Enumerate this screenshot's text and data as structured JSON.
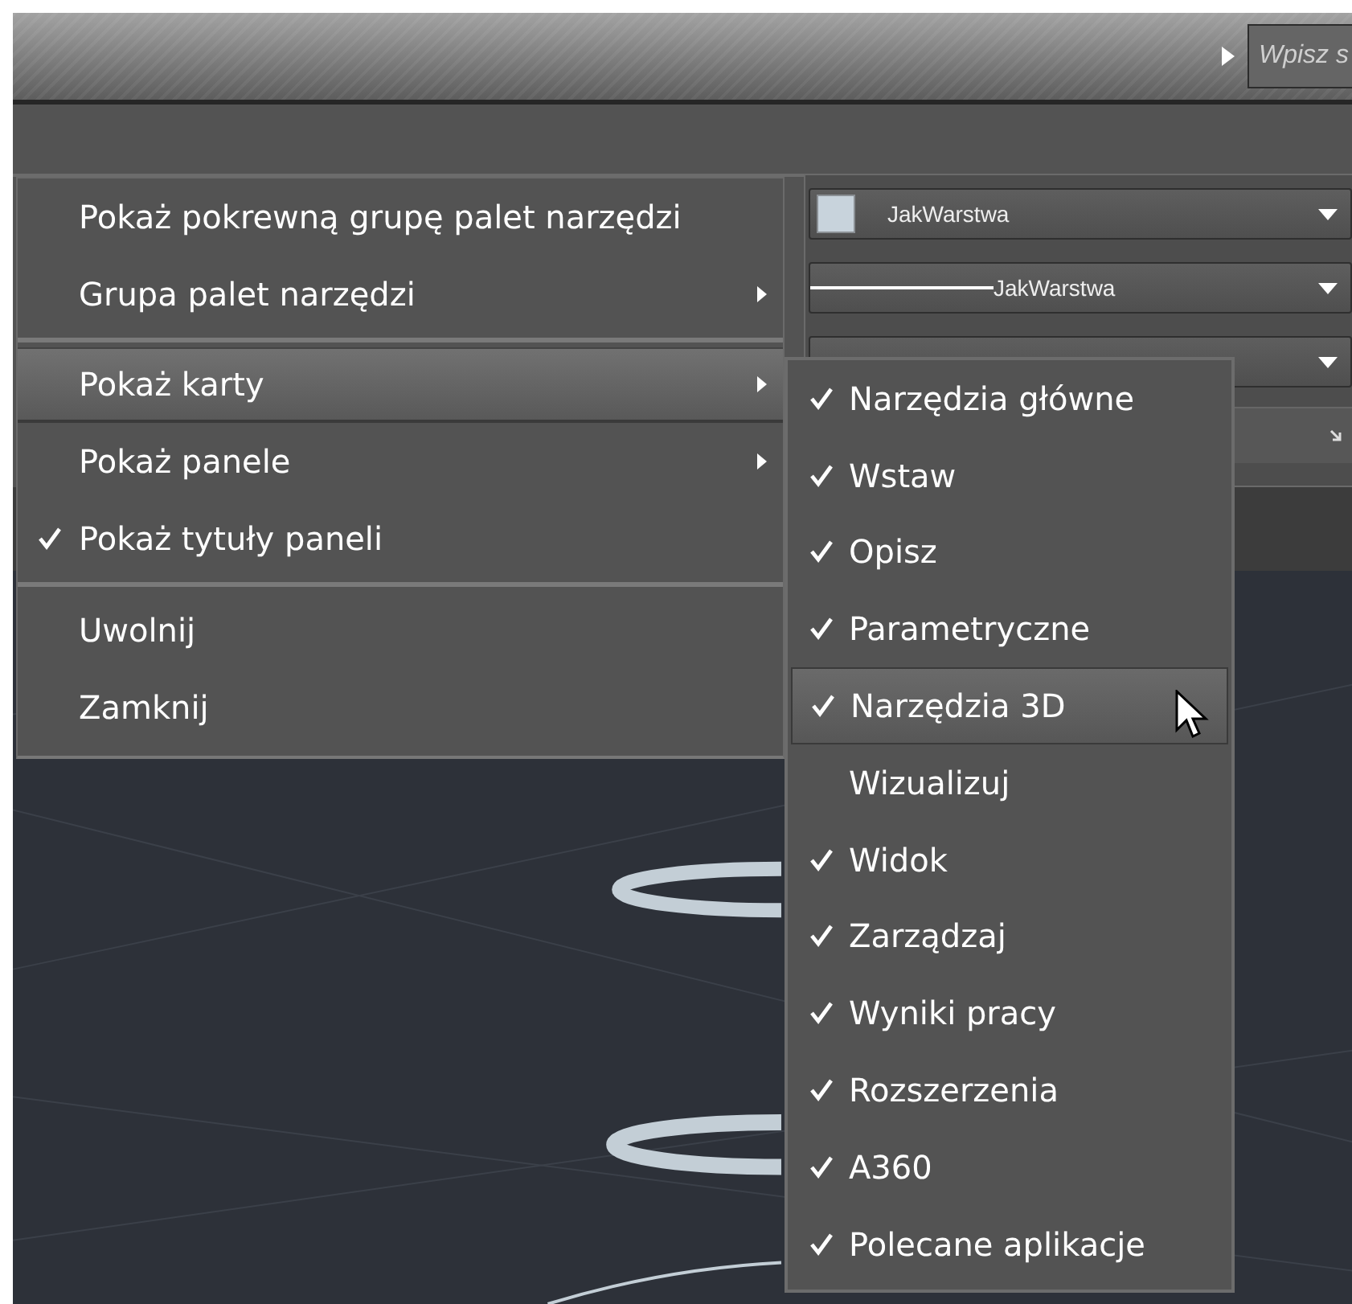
{
  "search": {
    "placeholder": "Wpisz s"
  },
  "ribbon_controls": [
    {
      "kind": "color",
      "value": "JakWarstwa"
    },
    {
      "kind": "linetype",
      "value": "JakWarstwa"
    },
    {
      "kind": "plain"
    }
  ],
  "context_menu": {
    "groups": [
      [
        {
          "label": "Pokaż pokrewną grupę palet narzędzi",
          "submenu": false,
          "checked": false,
          "selected": false
        },
        {
          "label": "Grupa palet narzędzi",
          "submenu": true,
          "checked": false,
          "selected": false
        }
      ],
      [
        {
          "label": "Pokaż karty",
          "submenu": true,
          "checked": false,
          "selected": true
        },
        {
          "label": "Pokaż panele",
          "submenu": true,
          "checked": false,
          "selected": false
        },
        {
          "label": "Pokaż tytuły paneli",
          "submenu": false,
          "checked": true,
          "selected": false
        }
      ],
      [
        {
          "label": "Uwolnij",
          "submenu": false,
          "checked": false,
          "selected": false
        },
        {
          "label": "Zamknij",
          "submenu": false,
          "checked": false,
          "selected": false
        }
      ]
    ]
  },
  "submenu": {
    "items": [
      {
        "label": "Narzędzia główne",
        "checked": true,
        "selected": false
      },
      {
        "label": "Wstaw",
        "checked": true,
        "selected": false
      },
      {
        "label": "Opisz",
        "checked": true,
        "selected": false
      },
      {
        "label": "Parametryczne",
        "checked": true,
        "selected": false
      },
      {
        "label": "Narzędzia 3D",
        "checked": true,
        "selected": true
      },
      {
        "label": "Wizualizuj",
        "checked": false,
        "selected": false
      },
      {
        "label": "Widok",
        "checked": true,
        "selected": false
      },
      {
        "label": "Zarządzaj",
        "checked": true,
        "selected": false
      },
      {
        "label": "Wyniki pracy",
        "checked": true,
        "selected": false
      },
      {
        "label": "Rozszerzenia",
        "checked": true,
        "selected": false
      },
      {
        "label": "A360",
        "checked": true,
        "selected": false
      },
      {
        "label": "Polecane aplikacje",
        "checked": true,
        "selected": false
      }
    ]
  }
}
